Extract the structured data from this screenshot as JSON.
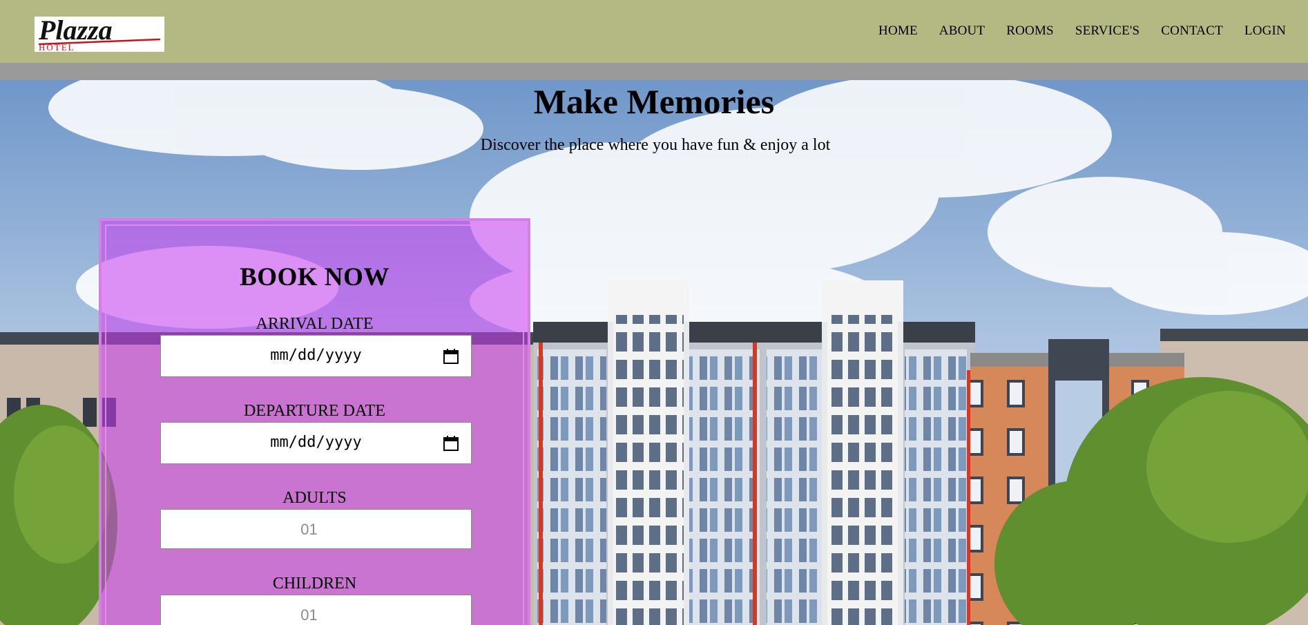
{
  "header": {
    "nav": [
      "HOME",
      "ABOUT",
      "ROOMS",
      "SERVICE'S",
      "CONTACT",
      "LOGIN"
    ]
  },
  "logo": {
    "name_text": "Plazza",
    "sub_text": "HOTEL"
  },
  "hero": {
    "title": "Make Memories",
    "subtitle": "Discover the place where you have fun & enjoy a lot"
  },
  "booking": {
    "title": "BOOK NOW",
    "arrival_label": "ARRIVAL DATE",
    "arrival_value": "mm/dd/yyyy",
    "departure_label": "DEPARTURE DATE",
    "departure_value": "mm/dd/yyyy",
    "adults_label": "ADULTS",
    "adults_placeholder": "01",
    "children_label": "CHILDREN",
    "children_placeholder": "01"
  },
  "colors": {
    "header_bg": "#b4b883",
    "strip_bg": "#9a9a9a",
    "booking_overlay": "#c83cf0",
    "booking_border": "#d77ce8"
  },
  "icons": [
    "calendar-icon"
  ]
}
